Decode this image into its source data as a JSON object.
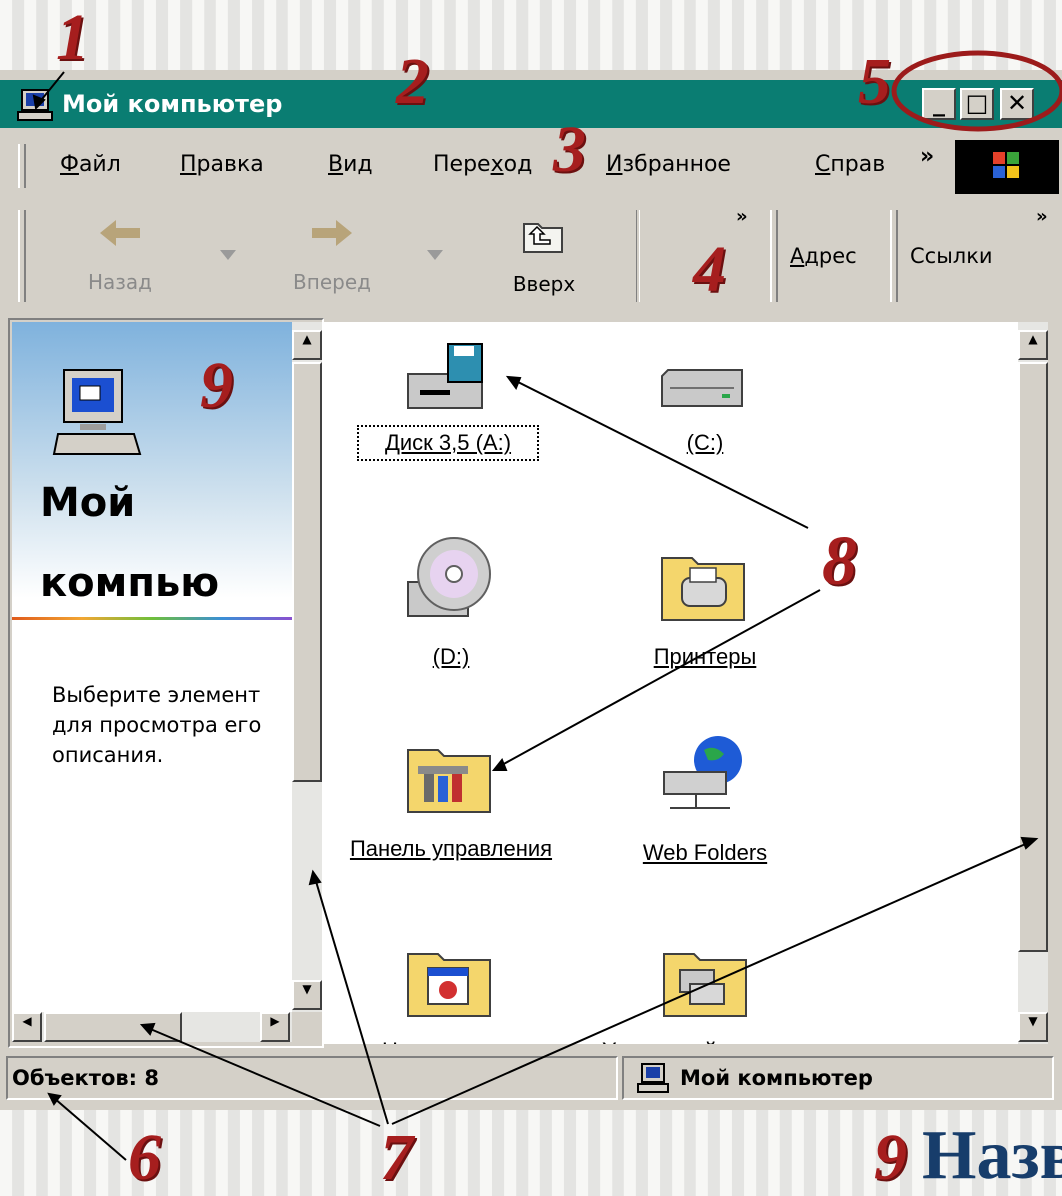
{
  "window": {
    "title": "Мой компьютер",
    "controls": {
      "minimize": "_",
      "maximize": "□",
      "close": "✕"
    }
  },
  "menu": {
    "items": [
      {
        "label_ul": "Ф",
        "label_rest": "айл"
      },
      {
        "label_ul": "П",
        "label_rest": "равка"
      },
      {
        "label_ul": "В",
        "label_rest": "ид"
      },
      {
        "label_pre": "Пере",
        "label_ul": "х",
        "label_rest": "од"
      },
      {
        "label_ul": "И",
        "label_rest": "збранное"
      },
      {
        "label_ul": "С",
        "label_rest": "прав"
      }
    ],
    "more": "»"
  },
  "toolbar": {
    "back": "Назад",
    "forward": "Вперед",
    "up": "Вверх",
    "more": "»",
    "address_ul": "А",
    "address_rest": "дрес",
    "links": "Ссылки",
    "links_more": "»"
  },
  "left_pane": {
    "title_line1": "Мой",
    "title_line2": "компью",
    "description": "Выберите элемент для просмотра его описания."
  },
  "items": [
    {
      "label": "Диск 3,5 (A:)",
      "icon": "floppy-drive-icon"
    },
    {
      "label": "(C:)",
      "icon": "hard-drive-icon"
    },
    {
      "label": "(D:)",
      "icon": "cd-drive-icon"
    },
    {
      "label": "Принтеры",
      "icon": "printers-folder-icon"
    },
    {
      "label": "Панель управления",
      "icon": "control-panel-folder-icon"
    },
    {
      "label": "Web Folders",
      "icon": "web-folders-icon"
    },
    {
      "label": "Назначенные задания",
      "icon": "scheduled-tasks-folder-icon"
    },
    {
      "label": "Удаленный доступ к сети",
      "icon": "dialup-folder-icon"
    }
  ],
  "status": {
    "objects": "Объектов: 8",
    "location": "Мой компьютер"
  },
  "annotations": {
    "n1": "1",
    "n2": "2",
    "n3": "3",
    "n4": "4",
    "n5": "5",
    "n6": "6",
    "n7": "7",
    "n8": "8",
    "n9_top": "9",
    "n9_bottom": "9",
    "caption": "Назва"
  },
  "colors": {
    "titlebar": "#0a7d72",
    "annotation": "#a61e1e",
    "caption": "#173d6b",
    "face": "#d4d0c8"
  }
}
